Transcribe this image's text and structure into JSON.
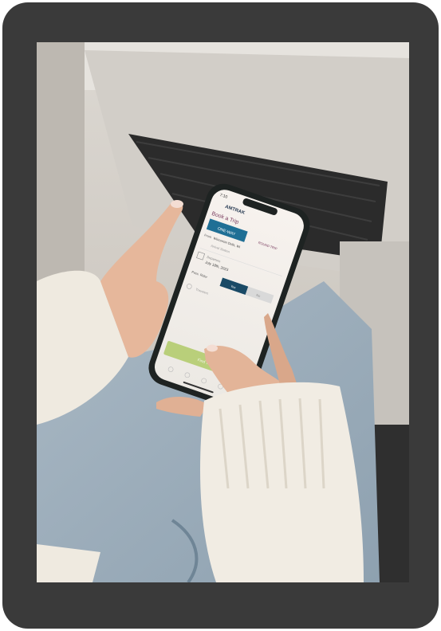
{
  "phone": {
    "status_time": "7:10",
    "brand": "AMTRAK",
    "screen_title": "Book a Trip",
    "trip_type_tab": "ONE-WAY",
    "from_label": "From",
    "from_value": "Wisconsin Dells, WI",
    "round_trip_label": "ROUND TRIP",
    "to_placeholder": "Arrival Station",
    "departure_label": "Departure",
    "departure_value": "July 18th, 2023",
    "passengers_label": "Pass. Rider",
    "toggle_yes": "Yes",
    "toggle_no": "No",
    "travelers_label": "Travelers",
    "find_trains_button": "Find Trains"
  },
  "colors": {
    "bezel": "#3a3a3a",
    "accent_blue": "#1f6f95",
    "button_green": "#b9cf7a",
    "sweater": "#efeae0"
  }
}
